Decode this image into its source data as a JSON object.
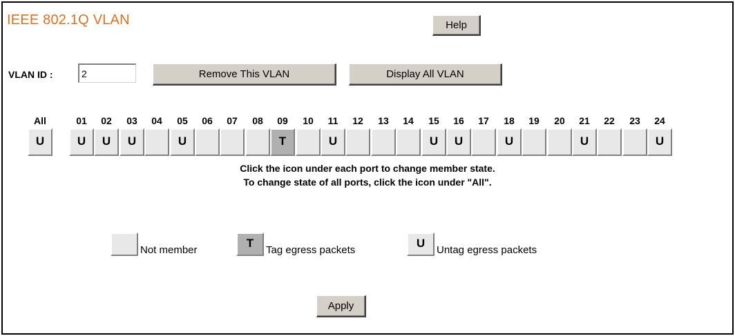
{
  "page": {
    "title": "IEEE 802.1Q VLAN",
    "help_label": "Help"
  },
  "vlan": {
    "id_label": "VLAN ID :",
    "id_value": "2",
    "remove_label": "Remove This VLAN",
    "display_all_label": "Display All VLAN"
  },
  "ports": {
    "all": {
      "label": "All",
      "state": "U"
    },
    "items": [
      {
        "label": "01",
        "state": "U"
      },
      {
        "label": "02",
        "state": "U"
      },
      {
        "label": "03",
        "state": "U"
      },
      {
        "label": "04",
        "state": ""
      },
      {
        "label": "05",
        "state": "U"
      },
      {
        "label": "06",
        "state": ""
      },
      {
        "label": "07",
        "state": ""
      },
      {
        "label": "08",
        "state": ""
      },
      {
        "label": "09",
        "state": "T"
      },
      {
        "label": "10",
        "state": ""
      },
      {
        "label": "11",
        "state": "U"
      },
      {
        "label": "12",
        "state": ""
      },
      {
        "label": "13",
        "state": ""
      },
      {
        "label": "14",
        "state": ""
      },
      {
        "label": "15",
        "state": "U"
      },
      {
        "label": "16",
        "state": "U"
      },
      {
        "label": "17",
        "state": ""
      },
      {
        "label": "18",
        "state": "U"
      },
      {
        "label": "19",
        "state": ""
      },
      {
        "label": "20",
        "state": ""
      },
      {
        "label": "21",
        "state": "U"
      },
      {
        "label": "22",
        "state": ""
      },
      {
        "label": "23",
        "state": ""
      },
      {
        "label": "24",
        "state": "U"
      }
    ]
  },
  "hints": {
    "line1": "Click the icon under each port to change member state.",
    "line2": "To change state of all ports, click the icon under \"All\"."
  },
  "legend": {
    "not_member": "Not member",
    "tag_symbol": "T",
    "tag": "Tag egress packets",
    "untag_symbol": "U",
    "untag": "Untag egress packets"
  },
  "apply_label": "Apply"
}
